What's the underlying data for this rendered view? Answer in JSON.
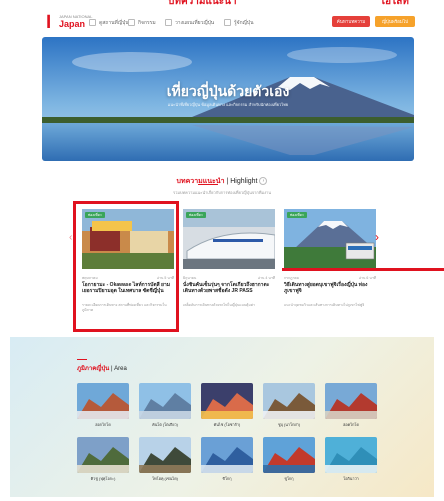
{
  "top_caption": {
    "left": "บทความแนะนำ",
    "right": "ไฮไลท์"
  },
  "header": {
    "logo_small": "JAPAN NATIONAL",
    "logo_big": "Japan",
    "nav": [
      "ดูสถานที่ญี่ปุ่น",
      "กิจกรรม",
      "วางแผนเที่ยวญี่ปุ่น",
      "รู้จักญี่ปุ่น"
    ],
    "btn_search": "ค้นหาบทความ",
    "btn_login": "ญี่ปุ่นพร้อมไป"
  },
  "hero": {
    "title": "เที่ยวญี่ปุ่นด้วยตัวเอง",
    "subtitle": "แนะนำที่เที่ยวญี่ปุ่น ข้อมูลเดินทาง และกิจกรรม สำหรับนักท่องเที่ยวไทย"
  },
  "highlight": {
    "title_red": "บทความแนะนำ",
    "title_rest": "| Highlight",
    "subtitle": "รวมบทความแนะนำเกี่ยวกับการท่องเที่ยวญี่ปุ่นจากทีมงาน"
  },
  "articles": [
    {
      "tag": "ท่องเที่ยว",
      "date": "พฤษภาคม",
      "views": "อ่าน 5 นาที",
      "title": "โอกายามะ - Okawase ไลท์การบัตสี ยามเยอรามปิยามอุด ในเทศบาล ซัดชีญี่ปุ่น",
      "desc": "รายละเอียดการเดินทาง สถานที่ท่องเที่ยว และกิจกรรมในภูมิภาค"
    },
    {
      "tag": "ท่องเที่ยว",
      "date": "มิถุนายน",
      "views": "อ่าน 4 นาที",
      "title": "นั่งชินคันเซ็นรุ่นๆ จากโตเกียวถึงฮากาตะ เดินทางด้วยพาสชื่อดัง JR PASS",
      "desc": "เคล็ดลับการเดินทางด้วยรถไฟในญี่ปุ่นแบบคุ้มค่า"
    },
    {
      "tag": "ท่องเที่ยว",
      "date": "กรกฎาคม",
      "views": "อ่าน 6 นาที",
      "title": "วิธีเดินทางสู่ยอดบุเขาฟูจิเรื่องญี่ปุ่น ท่องภูเขาฟูจิ",
      "desc": "แนะนำจุดชมวิวและเส้นทางการเดินทางไปภูเขาไฟฟูจิ"
    }
  ],
  "area": {
    "title_red": "ภูมิภาคญี่ปุ่น",
    "title_rest": "| Area",
    "regions": [
      "ฮอกไกโด",
      "คันโต (โตเกียว)",
      "คันไซ (โอซาก้า)",
      "ชูบุ (นาโกย่า)",
      "ฮอคไกโด",
      "คิวชู (ฟุคุโอกะ)",
      "โทโฮคุ (เซนได)",
      "ชิโกกุ",
      "ชูโกกุ",
      "โอกินาว่า"
    ]
  }
}
